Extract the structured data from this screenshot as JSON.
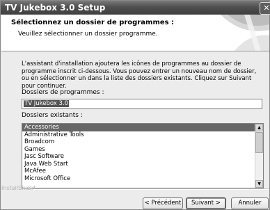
{
  "window": {
    "title": "TV Jukebox 3.0 Setup",
    "close_glyph": "✕"
  },
  "header": {
    "title": "Sélectionnez un dossier de programmes :",
    "subtitle": "Veuillez sélectionner un dossier programme."
  },
  "description": "L'assistant d'installation ajoutera les icônes de programmes au dossier de programme inscrit ci-dessous.  Vous pouvez entrer un nouveau nom de dossier, ou en sélectionner un dans la liste des dossiers existants.  Cliquez sur Suivant pour continuer.",
  "program_folder": {
    "label": "Dossiers de programmes :",
    "value": "TV Jukebox 3.0"
  },
  "existing_folders": {
    "label": "Dossiers existants :",
    "items": [
      "Accessories",
      "Administrative Tools",
      "Broadcom",
      "Games",
      "Jasc Software",
      "Java Web Start",
      "McAfee",
      "Microsoft Office"
    ],
    "selected": "Accessories"
  },
  "branding": "InstallShield",
  "buttons": {
    "back": "< Précédent",
    "next": "Suivant >",
    "cancel": "Annuler"
  },
  "icons": {
    "close": "close-icon",
    "scroll_up": "scroll-up-arrow-icon",
    "scroll_down": "scroll-down-arrow-icon"
  }
}
